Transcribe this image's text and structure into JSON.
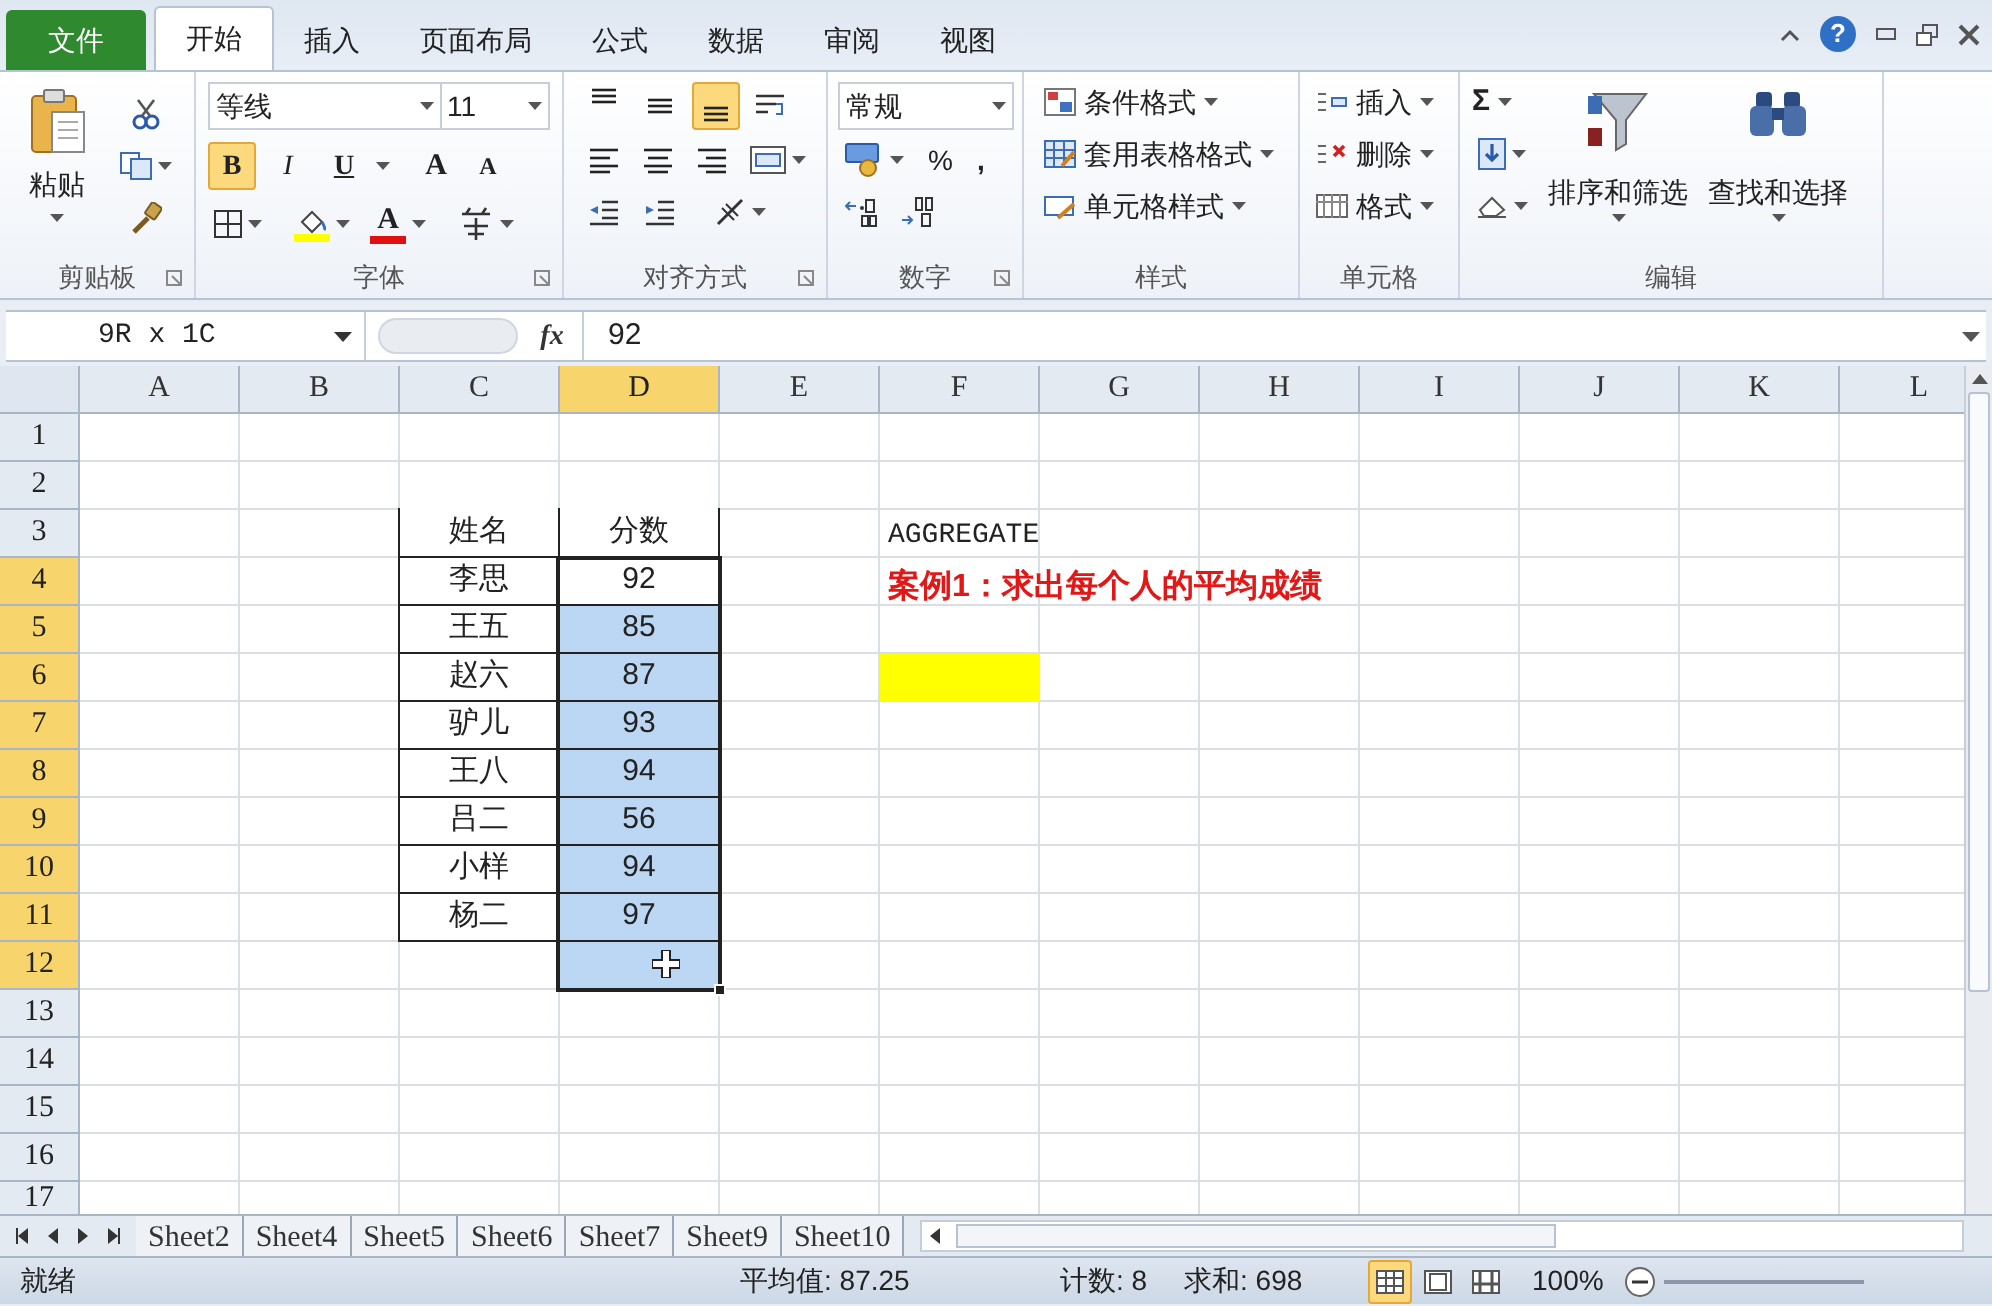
{
  "menu_tabs": [
    {
      "label": "文件",
      "kind": "file",
      "selected": false
    },
    {
      "label": "开始",
      "kind": "tab",
      "selected": true
    },
    {
      "label": "插入",
      "kind": "tab",
      "selected": false
    },
    {
      "label": "页面布局",
      "kind": "tab",
      "selected": false
    },
    {
      "label": "公式",
      "kind": "tab",
      "selected": false
    },
    {
      "label": "数据",
      "kind": "tab",
      "selected": false
    },
    {
      "label": "审阅",
      "kind": "tab",
      "selected": false
    },
    {
      "label": "视图",
      "kind": "tab",
      "selected": false
    }
  ],
  "window_controls": {
    "help": "?"
  },
  "ribbon": {
    "clipboard": {
      "paste": "粘贴",
      "title": "剪贴板"
    },
    "font": {
      "font_name": "等线",
      "font_size": "11",
      "styles": [
        {
          "label": "B",
          "kind": "bold",
          "selected": true
        },
        {
          "label": "I",
          "kind": "italic",
          "selected": false
        },
        {
          "label": "U",
          "kind": "underline",
          "selected": false
        }
      ],
      "grow": "A",
      "shrink": "A",
      "font_color": "A",
      "title": "字体"
    },
    "alignment": {
      "vertical": [
        {
          "kind": "top",
          "selected": false
        },
        {
          "kind": "middle",
          "selected": false
        },
        {
          "kind": "bottom",
          "selected": true
        }
      ],
      "title": "对齐方式"
    },
    "number": {
      "format": "常规",
      "percent": "%",
      "comma": ",",
      "title": "数字"
    },
    "styles": {
      "items": [
        "条件格式",
        "套用表格格式",
        "单元格样式"
      ],
      "title": "样式"
    },
    "cells": {
      "items": [
        "插入",
        "删除",
        "格式"
      ],
      "title": "单元格"
    },
    "editing": {
      "sum": "Σ",
      "sort": "排序和筛选",
      "find": "查找和选择",
      "title": "编辑"
    }
  },
  "formula_bar": {
    "name_box": "9R x 1C",
    "fx": "fx",
    "value": "92"
  },
  "sheet": {
    "columns": [
      {
        "label": "A",
        "selected": false
      },
      {
        "label": "B",
        "selected": false
      },
      {
        "label": "C",
        "selected": false
      },
      {
        "label": "D",
        "selected": true
      },
      {
        "label": "E",
        "selected": false
      },
      {
        "label": "F",
        "selected": false
      },
      {
        "label": "G",
        "selected": false
      },
      {
        "label": "H",
        "selected": false
      },
      {
        "label": "I",
        "selected": false
      },
      {
        "label": "J",
        "selected": false
      },
      {
        "label": "K",
        "selected": false
      },
      {
        "label": "L",
        "selected": false
      }
    ],
    "rows": [
      {
        "label": "1",
        "selected": false
      },
      {
        "label": "2",
        "selected": false
      },
      {
        "label": "3",
        "selected": false,
        "cells": [
          null,
          null,
          {
            "text": "姓名",
            "kind": "table",
            "selected": false
          },
          {
            "text": "分数",
            "kind": "table",
            "selected": false
          },
          null,
          {
            "text": "AGGREGATE",
            "kind": "plain",
            "selected": false
          }
        ]
      },
      {
        "label": "4",
        "selected": true,
        "cells": [
          null,
          null,
          {
            "text": "李思",
            "kind": "table",
            "selected": false
          },
          {
            "text": "92",
            "kind": "table",
            "selected": true
          },
          null,
          {
            "text": "案例1：求出每个人的平均成绩",
            "kind": "note",
            "selected": false
          }
        ]
      },
      {
        "label": "5",
        "selected": true,
        "cells": [
          null,
          null,
          {
            "text": "王五",
            "kind": "table",
            "selected": false
          },
          {
            "text": "85",
            "kind": "table",
            "selected": true
          }
        ]
      },
      {
        "label": "6",
        "selected": true,
        "cells": [
          null,
          null,
          {
            "text": "赵六",
            "kind": "table",
            "selected": false
          },
          {
            "text": "87",
            "kind": "table",
            "selected": true
          },
          null,
          {
            "kind": "fill",
            "color": "#ffff00",
            "selected": false
          }
        ]
      },
      {
        "label": "7",
        "selected": true,
        "cells": [
          null,
          null,
          {
            "text": "驴儿",
            "kind": "table",
            "selected": false
          },
          {
            "text": "93",
            "kind": "table",
            "selected": true
          }
        ]
      },
      {
        "label": "8",
        "selected": true,
        "cells": [
          null,
          null,
          {
            "text": "王八",
            "kind": "table",
            "selected": false
          },
          {
            "text": "94",
            "kind": "table",
            "selected": true
          }
        ]
      },
      {
        "label": "9",
        "selected": true,
        "cells": [
          null,
          null,
          {
            "text": "吕二",
            "kind": "table",
            "selected": false
          },
          {
            "text": "56",
            "kind": "table",
            "selected": true
          }
        ]
      },
      {
        "label": "10",
        "selected": true,
        "cells": [
          null,
          null,
          {
            "text": "小样",
            "kind": "table",
            "selected": false
          },
          {
            "text": "94",
            "kind": "table",
            "selected": true
          }
        ]
      },
      {
        "label": "11",
        "selected": true,
        "cells": [
          null,
          null,
          {
            "text": "杨二",
            "kind": "table",
            "selected": false
          },
          {
            "text": "97",
            "kind": "table",
            "selected": true
          }
        ]
      },
      {
        "label": "12",
        "selected": true,
        "cells": [
          null,
          null,
          null,
          {
            "kind": "table",
            "selected": true
          }
        ]
      },
      {
        "label": "13",
        "selected": false
      },
      {
        "label": "14",
        "selected": false
      },
      {
        "label": "15",
        "selected": false
      },
      {
        "label": "16",
        "selected": false
      },
      {
        "label": "17",
        "selected": false
      }
    ]
  },
  "sheet_tabs": [
    {
      "label": "Sheet2",
      "selected": false
    },
    {
      "label": "Sheet4",
      "selected": false
    },
    {
      "label": "Sheet5",
      "selected": false
    },
    {
      "label": "Sheet6",
      "selected": false
    },
    {
      "label": "Sheet7",
      "selected": false
    },
    {
      "label": "Sheet9",
      "selected": false
    },
    {
      "label": "Sheet10",
      "selected": false
    }
  ],
  "status_bar": {
    "state": "就绪",
    "average": "平均值: 87.25",
    "count": "计数: 8",
    "sum": "求和: 698",
    "views": [
      {
        "kind": "normal",
        "selected": true
      },
      {
        "kind": "layout",
        "selected": false
      },
      {
        "kind": "break",
        "selected": false
      }
    ],
    "zoom": "100%"
  }
}
